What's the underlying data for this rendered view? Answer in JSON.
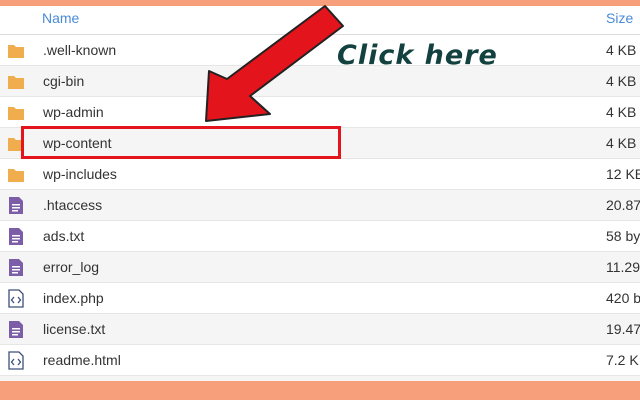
{
  "header": {
    "name_label": "Name",
    "size_label": "Size"
  },
  "rows": [
    {
      "icon": "folder-icon",
      "name": ".well-known",
      "size": "4 KB"
    },
    {
      "icon": "folder-icon",
      "name": "cgi-bin",
      "size": "4 KB"
    },
    {
      "icon": "folder-icon",
      "name": "wp-admin",
      "size": "4 KB"
    },
    {
      "icon": "folder-icon",
      "name": "wp-content",
      "size": "4 KB"
    },
    {
      "icon": "folder-icon",
      "name": "wp-includes",
      "size": "12 KB"
    },
    {
      "icon": "text-file-icon",
      "name": ".htaccess",
      "size": "20.87"
    },
    {
      "icon": "text-file-icon",
      "name": "ads.txt",
      "size": "58 by"
    },
    {
      "icon": "text-file-icon",
      "name": "error_log",
      "size": "11.29"
    },
    {
      "icon": "code-file-icon",
      "name": "index.php",
      "size": "420 b"
    },
    {
      "icon": "text-file-icon",
      "name": "license.txt",
      "size": "19.47"
    },
    {
      "icon": "code-file-icon",
      "name": "readme.html",
      "size": "7.2 KI"
    }
  ],
  "annotation": {
    "text": "Click here",
    "highlighted_row": "wp-content",
    "arrow_color": "#e3141b",
    "box_color": "#e3141b"
  },
  "colors": {
    "frame": "#f79e7a",
    "folder": "#f0ad4e",
    "file": "#7b5ea7",
    "link": "#4a8ad6"
  }
}
